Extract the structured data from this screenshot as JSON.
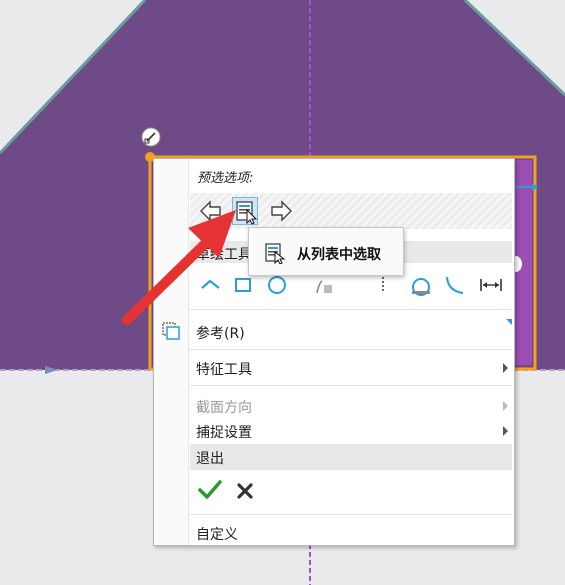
{
  "menu": {
    "prefs_title": "预选选项:",
    "sketch_tools_label": "草绘工具",
    "items": {
      "reference": "参考(R)",
      "feature_tools": "特征工具",
      "section_orientation": "截面方向",
      "snap_settings": "捕捉设置",
      "exit": "退出",
      "customize": "自定义"
    }
  },
  "tooltip": {
    "label": "从列表中选取"
  },
  "icons": {
    "prev": "arrow-left-icon",
    "pick_from_list": "pick-from-list-icon",
    "next": "arrow-right-icon",
    "ok": "checkmark-icon",
    "cancel": "cross-icon"
  },
  "colors": {
    "sketch_fill": "#6e4a86",
    "selection_orange": "#f4a020",
    "accent_blue": "#2a9fd6",
    "annotation_red": "#e53232",
    "ok_green": "#2d9a2d"
  }
}
